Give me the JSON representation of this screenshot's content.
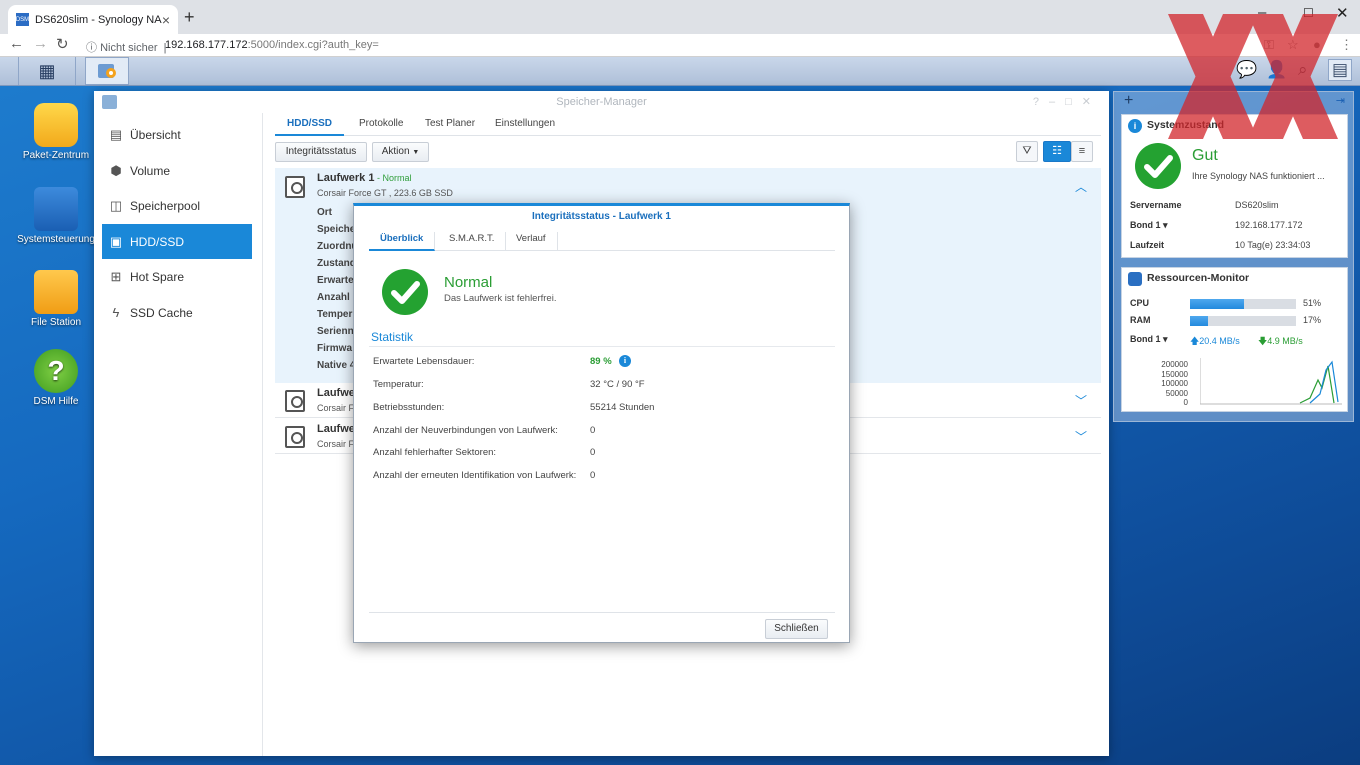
{
  "browser": {
    "tab_title": "DS620slim - Synology NAS",
    "favicon_text": "DSM",
    "security_label": "Nicht sicher",
    "url_host": "192.168.177.172",
    "url_rest": ":5000/index.cgi?auth_key="
  },
  "desktop": {
    "icons": [
      {
        "label": "Paket-Zentrum"
      },
      {
        "label": "Systemsteuerung"
      },
      {
        "label": "File Station"
      },
      {
        "label": "DSM Hilfe"
      }
    ]
  },
  "window": {
    "title": "Speicher-Manager",
    "sidebar": [
      {
        "label": "Übersicht"
      },
      {
        "label": "Volume"
      },
      {
        "label": "Speicherpool"
      },
      {
        "label": "HDD/SSD"
      },
      {
        "label": "Hot Spare"
      },
      {
        "label": "SSD Cache"
      }
    ],
    "tabs": [
      {
        "label": "HDD/SSD"
      },
      {
        "label": "Protokolle"
      },
      {
        "label": "Test Planer"
      },
      {
        "label": "Einstellungen"
      }
    ],
    "toolbar": {
      "integrity_button": "Integritätsstatus",
      "action_button": "Aktion"
    },
    "drives": [
      {
        "name": "Laufwerk 1",
        "status": " - Normal",
        "model": "Corsair Force GT , 223.6 GB SSD"
      },
      {
        "name": "Laufwe",
        "model": "Corsair F"
      },
      {
        "name": "Laufwe",
        "model": "Corsair F"
      }
    ],
    "drive1_props": [
      "Ort",
      "Speiche",
      "Zuordnu",
      "Zustand",
      "Erwarte",
      "Anzahl",
      "Temper",
      "Seriennu",
      "Firmwa",
      "Native 4"
    ]
  },
  "dialog": {
    "title": "Integritätsstatus - Laufwerk 1",
    "tabs": [
      {
        "label": "Überblick"
      },
      {
        "label": "S.M.A.R.T."
      },
      {
        "label": "Verlauf"
      }
    ],
    "status": "Normal",
    "status_sub": "Das Laufwerk ist fehlerfrei.",
    "section": "Statistik",
    "stats": [
      {
        "label": "Erwartete Lebensdauer:",
        "value": "89 %"
      },
      {
        "label": "Temperatur:",
        "value": "32 °C / 90 °F"
      },
      {
        "label": "Betriebsstunden:",
        "value": "55214 Stunden"
      },
      {
        "label": "Anzahl der Neuverbindungen von Laufwerk:",
        "value": "0"
      },
      {
        "label": "Anzahl fehlerhafter Sektoren:",
        "value": "0"
      },
      {
        "label": "Anzahl der erneuten Identifikation von Laufwerk:",
        "value": "0"
      }
    ],
    "close_button": "Schließen"
  },
  "widgets": {
    "system": {
      "title": "Systemzustand",
      "status": "Gut",
      "status_sub": "Ihre Synology NAS funktioniert ...",
      "rows": [
        {
          "label": "Servername",
          "value": "DS620slim"
        },
        {
          "label": "Bond 1 ▾",
          "value": "192.168.177.172"
        },
        {
          "label": "Laufzeit",
          "value": "10 Tag(e) 23:34:03"
        }
      ]
    },
    "resource": {
      "title": "Ressourcen-Monitor",
      "cpu_label": "CPU",
      "cpu_value": "51%",
      "cpu_percent": 51,
      "ram_label": "RAM",
      "ram_value": "17%",
      "ram_percent": 17,
      "net_label": "Bond 1 ▾",
      "upload": "20.4 MB/s",
      "download": "4.9 MB/s",
      "y_ticks": [
        "200000",
        "150000",
        "100000",
        "50000",
        "0"
      ]
    }
  },
  "colors": {
    "accent": "#1a88d8",
    "ok_green": "#24a231"
  }
}
